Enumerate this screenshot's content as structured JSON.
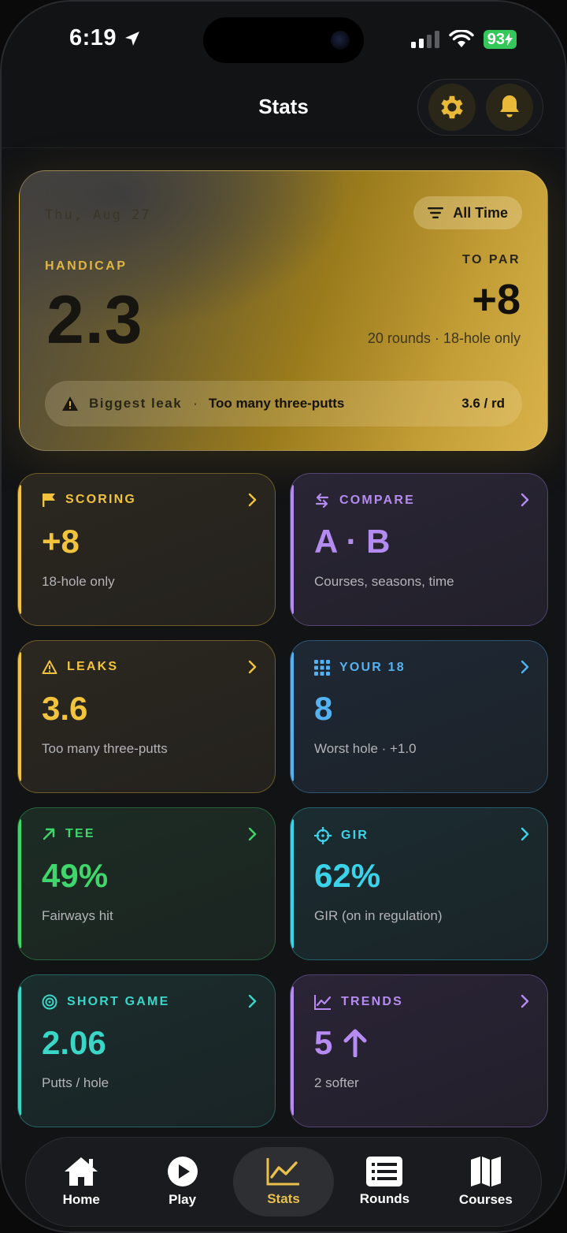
{
  "status_bar": {
    "time": "6:19",
    "battery": "93"
  },
  "header": {
    "title": "Stats"
  },
  "hero": {
    "date": "Thu, Aug 27",
    "range_label": "All Time",
    "handicap_label": "HANDICAP",
    "handicap_value": "2.3",
    "to_par_label": "TO PAR",
    "to_par_value": "+8",
    "rounds_sub": "20 rounds · 18-hole only",
    "leak_label": "Biggest leak",
    "leak_text": "Too many three-putts",
    "leak_rate": "3.6 / rd"
  },
  "tiles": {
    "scoring": {
      "title": "SCORING",
      "value": "+8",
      "sub": "18-hole only"
    },
    "compare": {
      "title": "COMPARE",
      "value": "A · B",
      "sub": "Courses, seasons, time"
    },
    "leaks": {
      "title": "LEAKS",
      "value": "3.6",
      "sub": "Too many three-putts"
    },
    "your18": {
      "title": "YOUR 18",
      "value": "8",
      "sub": "Worst hole · +1.0"
    },
    "tee": {
      "title": "TEE",
      "value": "49%",
      "sub": "Fairways hit"
    },
    "gir": {
      "title": "GIR",
      "value": "62%",
      "sub": "GIR (on in regulation)"
    },
    "short_game": {
      "title": "SHORT GAME",
      "value": "2.06",
      "sub": "Putts / hole"
    },
    "trends": {
      "title": "TRENDS",
      "value": "5",
      "sub": "2 softer"
    }
  },
  "tabbar": {
    "items": [
      {
        "label": "Home",
        "icon": "house-icon"
      },
      {
        "label": "Play",
        "icon": "play-icon"
      },
      {
        "label": "Stats",
        "icon": "chart-icon",
        "active": true
      },
      {
        "label": "Rounds",
        "icon": "list-icon"
      },
      {
        "label": "Courses",
        "icon": "map-icon"
      }
    ]
  },
  "colors": {
    "gold": "#f2c33d",
    "purple": "#b48bf0",
    "blue": "#53b3f2",
    "green": "#3fd66b",
    "cyan": "#3bd3ea",
    "teal": "#3ad6c8"
  }
}
